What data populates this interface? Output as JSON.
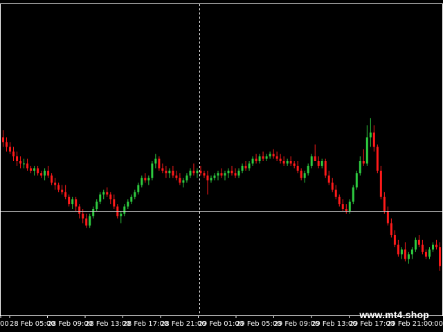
{
  "chart_data": {
    "type": "candlestick",
    "colors": {
      "background": "#000000",
      "up": "#2ecc40",
      "down": "#ff1a1a",
      "frame": "#ffffff",
      "crosshair": "#cfcfcf",
      "text": "#ffffff"
    },
    "x_ticks": [
      "28 Feb 05:00",
      "28 Feb 09:00",
      "28 Feb 13:00",
      "28 Feb 17:00",
      "28 Feb 21:00",
      "29 Feb 01:00",
      "29 Feb 05:00",
      "29 Feb 09:00",
      "29 Feb 13:00",
      "29 Feb 17:00",
      "29 Feb 21:00"
    ],
    "first_tick_partial": "00",
    "last_tick_partial": ":00",
    "price_range": [
      0,
      100
    ],
    "horizontal_line_level": 39,
    "vertical_line_position": 0.45,
    "candles": [
      {
        "o": 70,
        "h": 73,
        "l": 66,
        "c": 68
      },
      {
        "o": 68,
        "h": 70,
        "l": 64,
        "c": 66
      },
      {
        "o": 66,
        "h": 68,
        "l": 63,
        "c": 64
      },
      {
        "o": 64,
        "h": 66,
        "l": 60,
        "c": 62
      },
      {
        "o": 62,
        "h": 64,
        "l": 58,
        "c": 60
      },
      {
        "o": 60,
        "h": 62,
        "l": 57,
        "c": 59
      },
      {
        "o": 59,
        "h": 61,
        "l": 57,
        "c": 59
      },
      {
        "o": 59,
        "h": 61,
        "l": 56,
        "c": 57
      },
      {
        "o": 57,
        "h": 58,
        "l": 55,
        "c": 56
      },
      {
        "o": 56,
        "h": 58,
        "l": 54,
        "c": 57
      },
      {
        "o": 57,
        "h": 58,
        "l": 54,
        "c": 55
      },
      {
        "o": 55,
        "h": 56,
        "l": 53,
        "c": 54
      },
      {
        "o": 54,
        "h": 57,
        "l": 52,
        "c": 56
      },
      {
        "o": 56,
        "h": 58,
        "l": 53,
        "c": 54
      },
      {
        "o": 54,
        "h": 55,
        "l": 50,
        "c": 51
      },
      {
        "o": 51,
        "h": 53,
        "l": 48,
        "c": 50
      },
      {
        "o": 50,
        "h": 51,
        "l": 47,
        "c": 48
      },
      {
        "o": 48,
        "h": 50,
        "l": 46,
        "c": 47
      },
      {
        "o": 47,
        "h": 50,
        "l": 44,
        "c": 45
      },
      {
        "o": 45,
        "h": 46,
        "l": 41,
        "c": 42
      },
      {
        "o": 42,
        "h": 45,
        "l": 40,
        "c": 44
      },
      {
        "o": 44,
        "h": 45,
        "l": 39,
        "c": 41
      },
      {
        "o": 41,
        "h": 42,
        "l": 36,
        "c": 38
      },
      {
        "o": 38,
        "h": 40,
        "l": 34,
        "c": 36
      },
      {
        "o": 36,
        "h": 38,
        "l": 32,
        "c": 33
      },
      {
        "o": 33,
        "h": 38,
        "l": 32,
        "c": 37
      },
      {
        "o": 37,
        "h": 41,
        "l": 36,
        "c": 40
      },
      {
        "o": 40,
        "h": 44,
        "l": 39,
        "c": 43
      },
      {
        "o": 43,
        "h": 47,
        "l": 42,
        "c": 46
      },
      {
        "o": 46,
        "h": 48,
        "l": 44,
        "c": 47
      },
      {
        "o": 47,
        "h": 49,
        "l": 45,
        "c": 46
      },
      {
        "o": 46,
        "h": 47,
        "l": 42,
        "c": 44
      },
      {
        "o": 44,
        "h": 46,
        "l": 40,
        "c": 41
      },
      {
        "o": 41,
        "h": 42,
        "l": 36,
        "c": 37
      },
      {
        "o": 37,
        "h": 39,
        "l": 34,
        "c": 38
      },
      {
        "o": 38,
        "h": 42,
        "l": 37,
        "c": 41
      },
      {
        "o": 41,
        "h": 44,
        "l": 40,
        "c": 43
      },
      {
        "o": 43,
        "h": 46,
        "l": 42,
        "c": 45
      },
      {
        "o": 45,
        "h": 48,
        "l": 44,
        "c": 47
      },
      {
        "o": 47,
        "h": 51,
        "l": 46,
        "c": 50
      },
      {
        "o": 50,
        "h": 54,
        "l": 49,
        "c": 53
      },
      {
        "o": 53,
        "h": 55,
        "l": 51,
        "c": 52
      },
      {
        "o": 52,
        "h": 54,
        "l": 50,
        "c": 53
      },
      {
        "o": 53,
        "h": 60,
        "l": 52,
        "c": 59
      },
      {
        "o": 59,
        "h": 63,
        "l": 57,
        "c": 61
      },
      {
        "o": 61,
        "h": 62,
        "l": 56,
        "c": 57
      },
      {
        "o": 57,
        "h": 59,
        "l": 55,
        "c": 56
      },
      {
        "o": 56,
        "h": 58,
        "l": 53,
        "c": 55
      },
      {
        "o": 55,
        "h": 57,
        "l": 53,
        "c": 56
      },
      {
        "o": 56,
        "h": 58,
        "l": 53,
        "c": 54
      },
      {
        "o": 54,
        "h": 56,
        "l": 52,
        "c": 53
      },
      {
        "o": 53,
        "h": 55,
        "l": 50,
        "c": 51
      },
      {
        "o": 51,
        "h": 53,
        "l": 49,
        "c": 52
      },
      {
        "o": 52,
        "h": 55,
        "l": 51,
        "c": 54
      },
      {
        "o": 54,
        "h": 57,
        "l": 53,
        "c": 56
      },
      {
        "o": 56,
        "h": 59,
        "l": 54,
        "c": 55
      },
      {
        "o": 55,
        "h": 57,
        "l": 53,
        "c": 56
      },
      {
        "o": 56,
        "h": 58,
        "l": 54,
        "c": 55
      },
      {
        "o": 55,
        "h": 56,
        "l": 53,
        "c": 54
      },
      {
        "o": 54,
        "h": 56,
        "l": 46,
        "c": 52
      },
      {
        "o": 52,
        "h": 54,
        "l": 51,
        "c": 53
      },
      {
        "o": 53,
        "h": 55,
        "l": 52,
        "c": 54
      },
      {
        "o": 54,
        "h": 56,
        "l": 52,
        "c": 55
      },
      {
        "o": 55,
        "h": 57,
        "l": 53,
        "c": 54
      },
      {
        "o": 54,
        "h": 56,
        "l": 52,
        "c": 55
      },
      {
        "o": 55,
        "h": 57,
        "l": 53,
        "c": 56
      },
      {
        "o": 56,
        "h": 58,
        "l": 54,
        "c": 55
      },
      {
        "o": 55,
        "h": 57,
        "l": 53,
        "c": 54
      },
      {
        "o": 54,
        "h": 57,
        "l": 53,
        "c": 56
      },
      {
        "o": 56,
        "h": 59,
        "l": 55,
        "c": 58
      },
      {
        "o": 58,
        "h": 60,
        "l": 56,
        "c": 57
      },
      {
        "o": 57,
        "h": 60,
        "l": 56,
        "c": 59
      },
      {
        "o": 59,
        "h": 62,
        "l": 58,
        "c": 61
      },
      {
        "o": 61,
        "h": 63,
        "l": 59,
        "c": 60
      },
      {
        "o": 60,
        "h": 63,
        "l": 59,
        "c": 62
      },
      {
        "o": 62,
        "h": 64,
        "l": 60,
        "c": 61
      },
      {
        "o": 61,
        "h": 63,
        "l": 60,
        "c": 62
      },
      {
        "o": 62,
        "h": 64,
        "l": 61,
        "c": 63
      },
      {
        "o": 63,
        "h": 65,
        "l": 61,
        "c": 62
      },
      {
        "o": 62,
        "h": 64,
        "l": 60,
        "c": 61
      },
      {
        "o": 61,
        "h": 63,
        "l": 59,
        "c": 60
      },
      {
        "o": 60,
        "h": 62,
        "l": 58,
        "c": 59
      },
      {
        "o": 59,
        "h": 61,
        "l": 58,
        "c": 60
      },
      {
        "o": 60,
        "h": 62,
        "l": 58,
        "c": 59
      },
      {
        "o": 59,
        "h": 60,
        "l": 57,
        "c": 58
      },
      {
        "o": 58,
        "h": 60,
        "l": 55,
        "c": 56
      },
      {
        "o": 56,
        "h": 57,
        "l": 52,
        "c": 53
      },
      {
        "o": 53,
        "h": 56,
        "l": 51,
        "c": 55
      },
      {
        "o": 55,
        "h": 59,
        "l": 54,
        "c": 58
      },
      {
        "o": 58,
        "h": 63,
        "l": 57,
        "c": 62
      },
      {
        "o": 62,
        "h": 67,
        "l": 61,
        "c": 60
      },
      {
        "o": 60,
        "h": 62,
        "l": 57,
        "c": 58
      },
      {
        "o": 58,
        "h": 61,
        "l": 57,
        "c": 60
      },
      {
        "o": 60,
        "h": 61,
        "l": 53,
        "c": 54
      },
      {
        "o": 54,
        "h": 56,
        "l": 50,
        "c": 51
      },
      {
        "o": 51,
        "h": 53,
        "l": 47,
        "c": 48
      },
      {
        "o": 48,
        "h": 50,
        "l": 44,
        "c": 45
      },
      {
        "o": 45,
        "h": 46,
        "l": 41,
        "c": 42
      },
      {
        "o": 42,
        "h": 44,
        "l": 39,
        "c": 40
      },
      {
        "o": 40,
        "h": 42,
        "l": 38,
        "c": 39
      },
      {
        "o": 39,
        "h": 44,
        "l": 38,
        "c": 43
      },
      {
        "o": 43,
        "h": 50,
        "l": 42,
        "c": 49
      },
      {
        "o": 49,
        "h": 56,
        "l": 48,
        "c": 55
      },
      {
        "o": 55,
        "h": 62,
        "l": 54,
        "c": 60
      },
      {
        "o": 60,
        "h": 65,
        "l": 58,
        "c": 59
      },
      {
        "o": 59,
        "h": 75,
        "l": 58,
        "c": 70
      },
      {
        "o": 70,
        "h": 78,
        "l": 66,
        "c": 72
      },
      {
        "o": 72,
        "h": 75,
        "l": 64,
        "c": 66
      },
      {
        "o": 66,
        "h": 67,
        "l": 55,
        "c": 56
      },
      {
        "o": 56,
        "h": 58,
        "l": 44,
        "c": 45
      },
      {
        "o": 45,
        "h": 47,
        "l": 38,
        "c": 39
      },
      {
        "o": 39,
        "h": 41,
        "l": 33,
        "c": 34
      },
      {
        "o": 34,
        "h": 36,
        "l": 28,
        "c": 29
      },
      {
        "o": 29,
        "h": 31,
        "l": 24,
        "c": 25
      },
      {
        "o": 25,
        "h": 27,
        "l": 20,
        "c": 21
      },
      {
        "o": 21,
        "h": 24,
        "l": 19,
        "c": 23
      },
      {
        "o": 23,
        "h": 26,
        "l": 18,
        "c": 19
      },
      {
        "o": 19,
        "h": 22,
        "l": 17,
        "c": 21
      },
      {
        "o": 21,
        "h": 24,
        "l": 19,
        "c": 23
      },
      {
        "o": 23,
        "h": 28,
        "l": 22,
        "c": 27
      },
      {
        "o": 27,
        "h": 29,
        "l": 24,
        "c": 25
      },
      {
        "o": 25,
        "h": 27,
        "l": 21,
        "c": 22
      },
      {
        "o": 22,
        "h": 23,
        "l": 19,
        "c": 20
      },
      {
        "o": 20,
        "h": 24,
        "l": 19,
        "c": 23
      },
      {
        "o": 23,
        "h": 26,
        "l": 22,
        "c": 25
      },
      {
        "o": 25,
        "h": 27,
        "l": 23,
        "c": 24
      },
      {
        "o": 24,
        "h": 26,
        "l": 14,
        "c": 16
      }
    ]
  },
  "watermark": "www.mt4.shop"
}
